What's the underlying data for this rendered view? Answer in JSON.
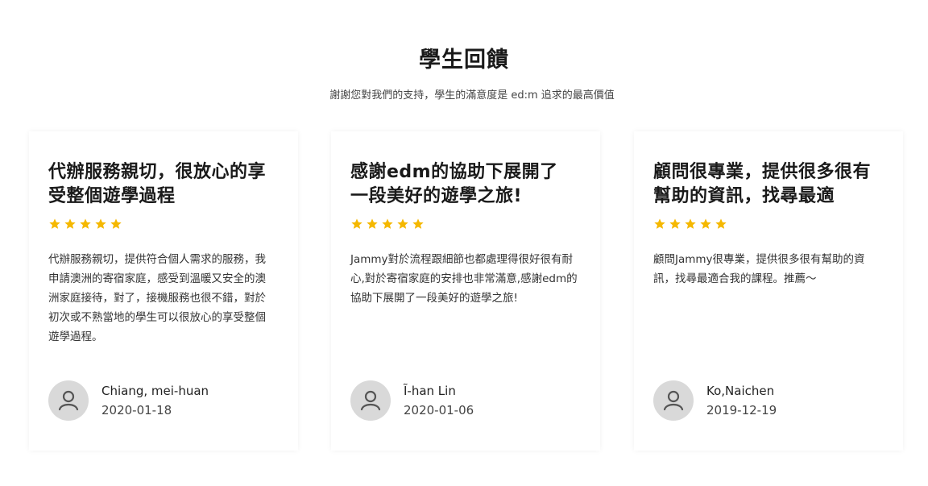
{
  "section": {
    "title": "學生回饋",
    "subtitle": "謝謝您對我們的支持，學生的滿意度是 ed:m 追求的最高價值"
  },
  "colors": {
    "star": "#f5b800",
    "avatar_bg": "#d9d9d9",
    "avatar_icon": "#555555"
  },
  "testimonials": [
    {
      "heading": "代辦服務親切，很放心的享受整個遊學過程",
      "rating": 5,
      "body": "代辦服務親切，提供符合個人需求的服務，我申請澳洲的寄宿家庭，感受到溫暖又安全的澳洲家庭接待，對了，接機服務也很不錯，對於初次或不熟當地的學生可以很放心的享受整個遊學過程。",
      "author": "Chiang, mei-huan",
      "date": "2020-01-18",
      "avatar_icon": "user-icon"
    },
    {
      "heading": "感謝edm的協助下展開了一段美好的遊學之旅!",
      "rating": 5,
      "body": "Jammy對於流程跟細節也都處理得很好很有耐心,對於寄宿家庭的安排也非常滿意,感謝edm的協助下展開了一段美好的遊學之旅!",
      "author": "Ĩ-han Lin",
      "date": "2020-01-06",
      "avatar_icon": "user-icon"
    },
    {
      "heading": "顧問很專業，提供很多很有幫助的資訊，找尋最適",
      "rating": 5,
      "body": "顧問Jammy很專業，提供很多很有幫助的資訊，找尋最適合我的課程。推薦～",
      "author": "Ko,Naichen",
      "date": "2019-12-19",
      "avatar_icon": "user-icon"
    }
  ]
}
